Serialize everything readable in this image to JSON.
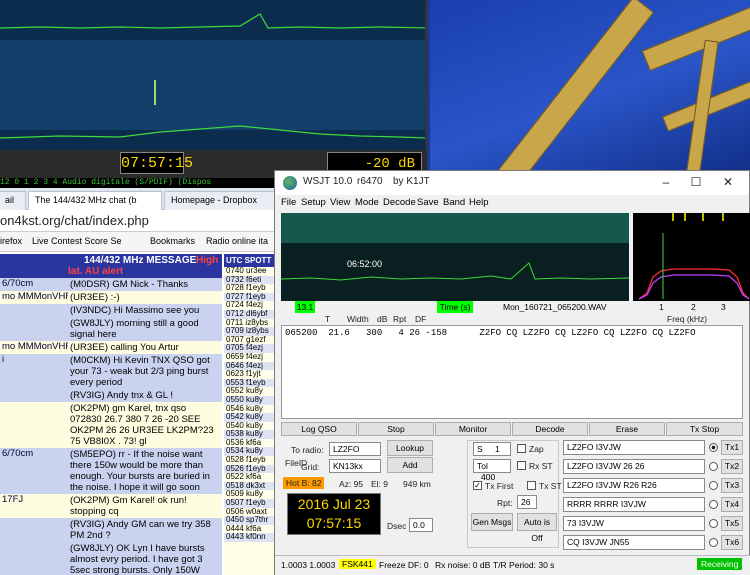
{
  "background_spectrum": {
    "clock": "07:57:15",
    "level": "-20 dB",
    "status_line": "12        0        1        2        3        4        Audio digitale (S/PDIF) (Dispos"
  },
  "browser": {
    "tabs": [
      {
        "label": "ail"
      },
      {
        "label": "The 144/432 MHz chat (b"
      },
      {
        "label": "Homepage - Dropbox"
      }
    ],
    "url": "on4kst.org/chat/index.php",
    "bookmarks": [
      "irefox",
      "Live Contest Score Se",
      "Bookmarks",
      "Radio online ita"
    ],
    "chat_header": "144/432 MHz MESSAGE",
    "chat_header_extra": "High",
    "chat_header_alert": "lat. AU alert",
    "chat_rows": [
      {
        "nick": "6/70cm",
        "msg": "(M0DSR) GM Nick - Thanks",
        "color": "blue"
      },
      {
        "nick": "mo MMMonVHF",
        "msg": "(UR3EE) :-)",
        "color": "yellow"
      },
      {
        "nick": "",
        "msg": "(IV3NDC) Hi Massimo see you",
        "color": "blue"
      },
      {
        "nick": "",
        "msg": "(GW8JLY) morning still a good signal here",
        "color": "blue"
      },
      {
        "nick": "mo MMMonVHF",
        "msg": "(UR3EE) calling You Artur",
        "color": "yellow"
      },
      {
        "nick": "i",
        "msg": "(M0CKM) Hi Kevin TNX QSO got your 73 - weak but 2/3 ping burst every period",
        "color": "blue"
      },
      {
        "nick": "",
        "msg": "(RV3IG) Andy tnx & GL !",
        "color": "blue"
      },
      {
        "nick": "",
        "msg": "(OK2PM) gm Karel, tnx qso 072830 26.7 380 7 26 -20 SEE OK2PM 26 26 UR3EE LK2PM?23 75 VB8I0X . 73! gl",
        "color": "yellow"
      },
      {
        "nick": "6/70cm",
        "msg": "(SM5EPO) rr - If the noise want there 150w would be more than enough. Your bursts are buried in the noise. I hope it will go soon",
        "color": "blue"
      },
      {
        "nick": "17FJ",
        "msg": "(OK2PM) Gm Karel! ok run! stopping cq",
        "color": "yellow"
      },
      {
        "nick": "",
        "msg": "(RV3IG) Andy GM can we try 358 PM 2nd ?",
        "color": "blue"
      },
      {
        "nick": "",
        "msg": "(GW8JLY) OK Lyn I have bursts almost evry period. I have got 3 5sec strong bursts. Only 150W here today",
        "color": "blue"
      }
    ],
    "spots_header": "UTC SPOTT",
    "spots": [
      "0740 ur3ee",
      "0732 f6eti",
      "0728 f1eyb",
      "0727 f1eyb",
      "0724 f4ezj",
      "0712 dl6ybf",
      "0711 iz8ybs",
      "0709 iz8ybs",
      "0707 g1ezf",
      "0705 f4ezj",
      "0659 f4ezj",
      "0646 f4ezj",
      "0623 f1yjt",
      "0553 f1eyb",
      "0552 ku8y",
      "0550 ku8y",
      "0546 ku8y",
      "0542 ku8y",
      "0540 ku8y",
      "0538 ku8y",
      "0536 kf6a",
      "0534 ku8y",
      "0528 f1eyb",
      "0526 f1eyb",
      "0522 kf6a",
      "0518 dk3xt",
      "0509 ku8y",
      "0507 f1eyb",
      "0506 w0axt",
      "0450 sp7thr",
      "0444 kf6a",
      "0443 kf0nn"
    ]
  },
  "wsjt": {
    "title": "WSJT 10.0",
    "revision": "r6470",
    "by": "by K1JT",
    "menu": [
      "File",
      "Setup",
      "View",
      "Mode",
      "Decode",
      "Save",
      "Band",
      "Help"
    ],
    "waterfall_time": "06:52:00",
    "labels": {
      "rx_level": "13.1",
      "time_s": "Time (s)",
      "wav_file": "Mon_160721_065200.WAV",
      "freq_ticks": [
        "1",
        "2",
        "3"
      ],
      "freq_label": "Freq (kHz)"
    },
    "decoded_columns": [
      "FileID",
      "T",
      "Width",
      "dB",
      "Rpt",
      "DF"
    ],
    "decoded_text": "065200  21.6   300   4 26 -158      Z2FO CQ LZ2FO CQ LZ2FO CQ LZ2FO CQ LZ2FO",
    "buttons": [
      "Log QSO",
      "Stop",
      "Monitor",
      "Decode",
      "Erase",
      "Tx Stop"
    ],
    "to_radio_label": "To radio:",
    "to_radio": "LZ2FO",
    "grid_label": "Grid:",
    "grid": "KN13kx",
    "lookup": "Lookup",
    "add": "Add",
    "hot_b": "Hot B: 82",
    "az": "Az: 95",
    "el": "El: 9",
    "dist": "949 km",
    "date": "2016 Jul 23",
    "utc": "07:57:15",
    "dsec_label": "Dsec",
    "dsec": "0.0",
    "s_label": "S",
    "s_val": "1",
    "tol_label": "Tol",
    "tol": "400",
    "zap": "Zap",
    "rx_st": "Rx ST",
    "tx_first": "Tx First",
    "tx_st": "Tx ST",
    "rpt_label": "Rpt:",
    "rpt": "26",
    "gen_msgs": "Gen Msgs",
    "auto_off": "Auto is Off",
    "tx_messages": [
      "LZ2FO I3VJW",
      "LZ2FO I3VJW 26 26",
      "LZ2FO I3VJW R26 R26",
      "RRRR RRRR I3VJW",
      "73 I3VJW",
      "CQ I3VJW JN55"
    ],
    "tx_labels": [
      "Tx1",
      "Tx2",
      "Tx3",
      "Tx4",
      "Tx5",
      "Tx6"
    ],
    "status": {
      "ratio": "1.0003 1.0003",
      "mode": "FSK441",
      "freeze": "Freeze DF:  0",
      "rxnoise": "Rx noise:  0 dB",
      "period": "T/R Period: 30 s",
      "state": "Receiving"
    },
    "colors": {
      "mode_bg": "#ffff00",
      "state_bg": "#00c000",
      "hot_bg": "#ff9900",
      "rx_bg": "#00ff00"
    }
  }
}
